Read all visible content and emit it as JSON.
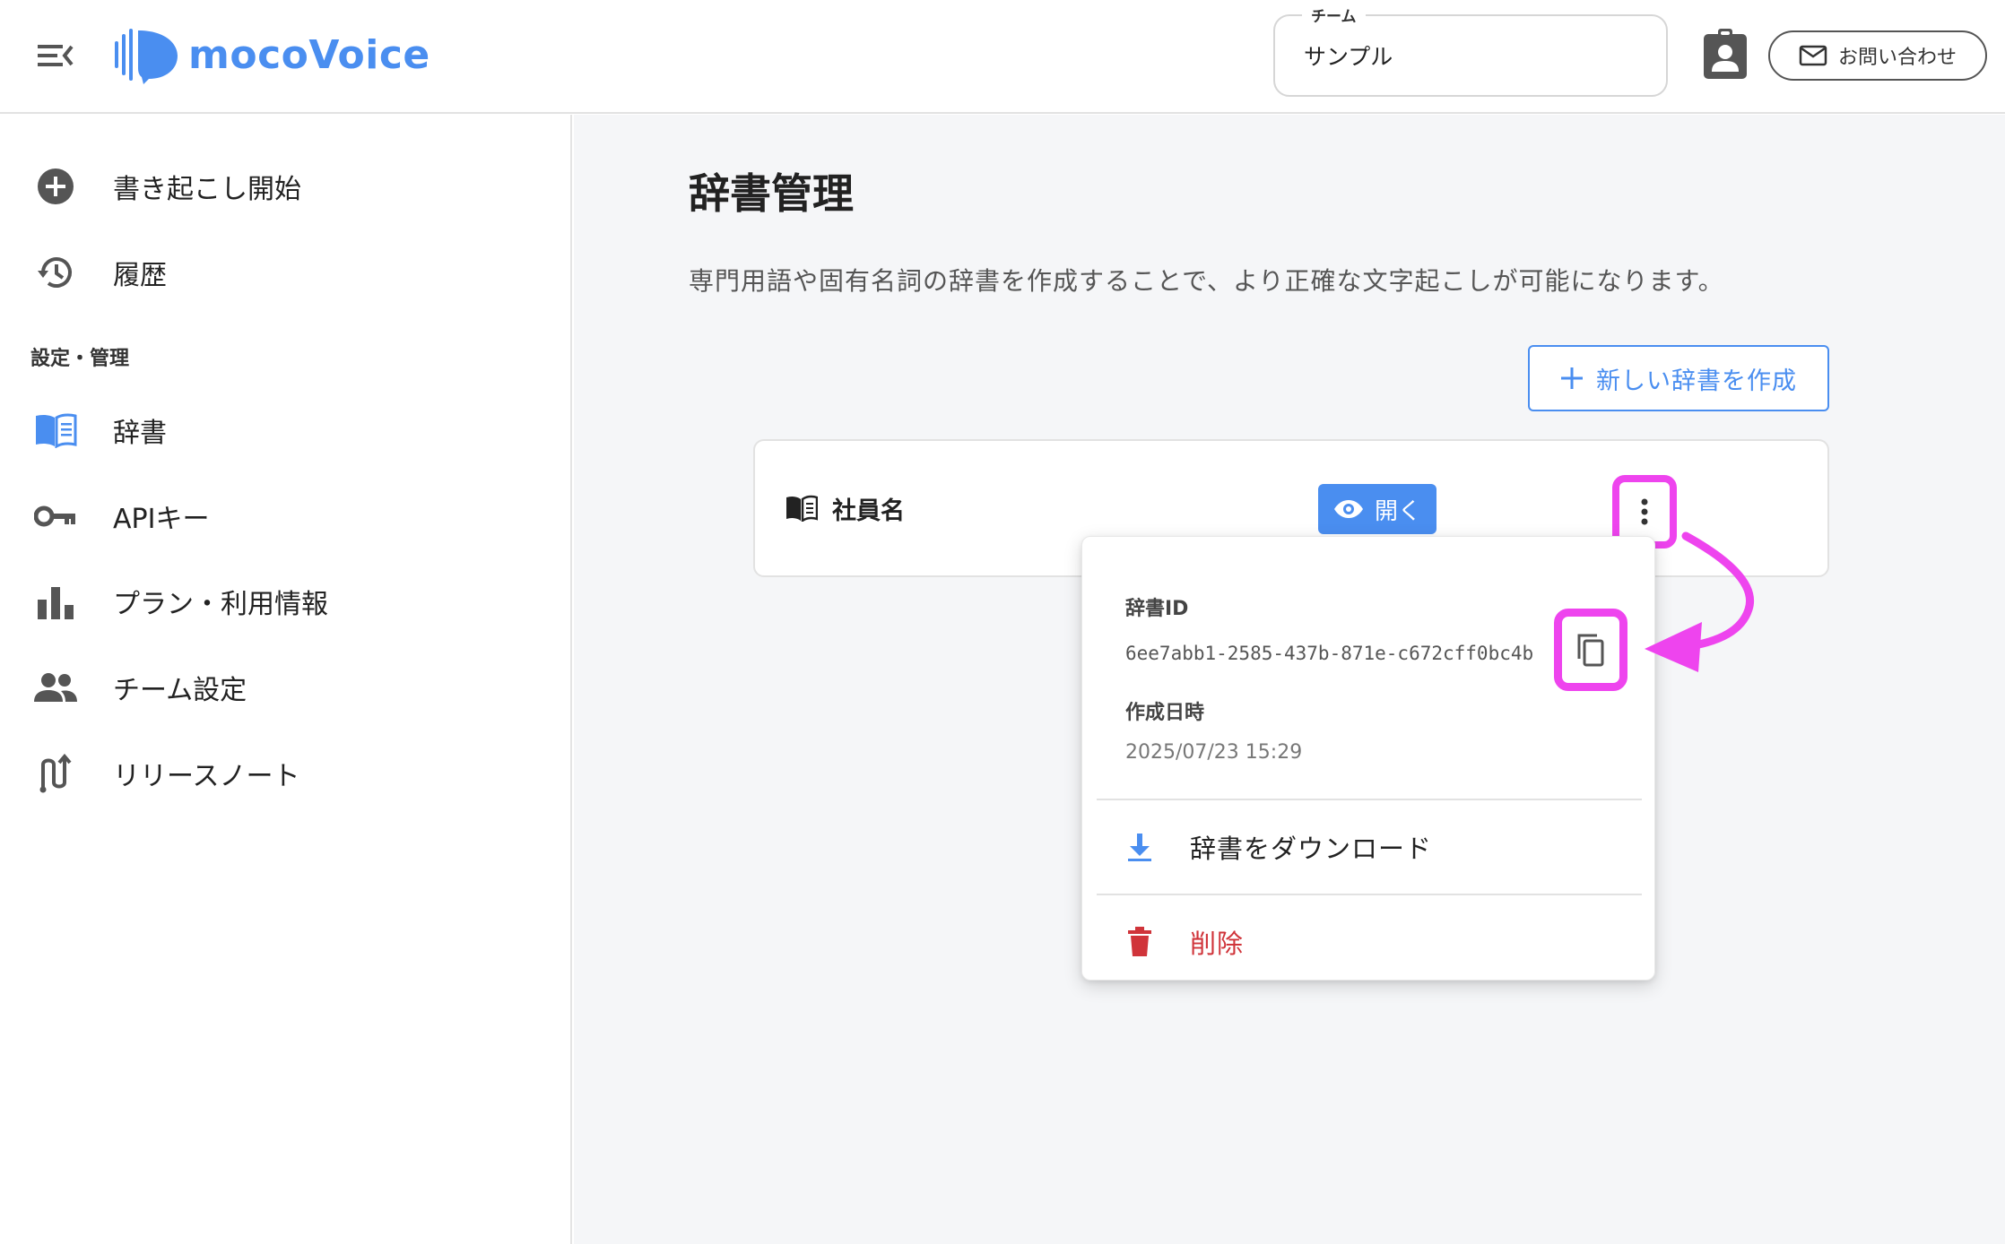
{
  "header": {
    "brand_name": "mocoVoice",
    "team_label": "チーム",
    "team_value": "サンプル",
    "contact_label": "お問い合わせ"
  },
  "sidebar": {
    "items_top": [
      {
        "label": "書き起こし開始",
        "icon": "add-circle-icon"
      },
      {
        "label": "履歴",
        "icon": "history-icon"
      }
    ],
    "section_title": "設定・管理",
    "items_settings": [
      {
        "label": "辞書",
        "icon": "book-icon",
        "active": true
      },
      {
        "label": "APIキー",
        "icon": "key-icon"
      },
      {
        "label": "プラン・利用情報",
        "icon": "bar-chart-icon"
      },
      {
        "label": "チーム設定",
        "icon": "people-icon"
      },
      {
        "label": "リリースノート",
        "icon": "release-note-icon"
      }
    ]
  },
  "main": {
    "title": "辞書管理",
    "description": "専門用語や固有名詞の辞書を作成することで、より正確な文字起こしが可能になります。",
    "new_button_label": "新しい辞書を作成",
    "card": {
      "name": "社員名",
      "open_label": "開く"
    },
    "menu": {
      "id_label": "辞書ID",
      "id_value": "6ee7abb1-2585-437b-871e-c672cff0bc4b",
      "created_label": "作成日時",
      "created_value": "2025/07/23 15:29",
      "download_label": "辞書をダウンロード",
      "delete_label": "削除"
    }
  },
  "colors": {
    "accent": "#4a8ef0",
    "highlight": "#ee44ee",
    "danger": "#d0343a"
  }
}
